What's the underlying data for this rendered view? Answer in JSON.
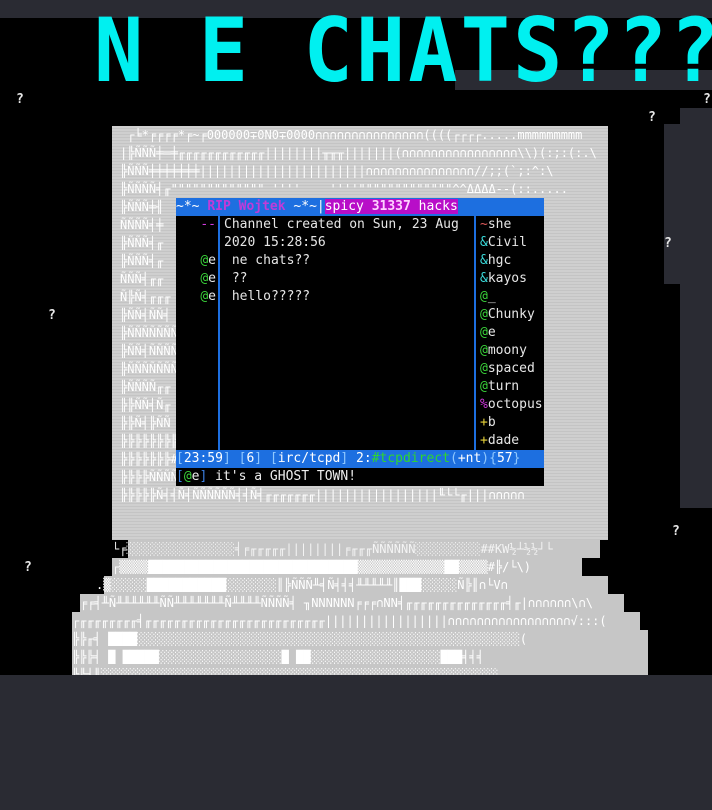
{
  "title": "N E CHATS???",
  "question_marks": [
    "?",
    "?",
    "?",
    "?",
    "?",
    "?",
    "?",
    "?"
  ],
  "ascii_art": {
    "monitor_lines": [
      " ┌╘*╒╒╒╒*╒~╒000000∓0N0∓0000∩∩∩∩∩∩∩∩∩∩∩∩∩∩∩((((┌┌┌┌.....mmmmmmmmm",
      "|╠ÑÑÑ╪═╪╓╓╓╓╓╓╓╓╓╓╓╓||||||||╥╥╥|||||||(∩∩∩∩∩∩∩∩∩∩∩∩∩∩∩∩\\\\)(:;:(:.\\",
      "╠ÑÑÑ╪╪╪╪╪╪╪|||||||||||||||||||||||∩∩∩∩∩∩∩∩∩∩∩∩∩∩∩//;;(`;:^:\\",
      "╠ÑÑÑÑ╡╓\"\"\"\"\"\"\"\"\"\"\"\"\" ''''    ''''\"\"\"\"\"\"\"\"\"\"\"\"\"^^ΔΔΔΔ--(::.....",
      "╠ÑÑÑ╪╢",
      "ÑÑÑÑ╡╪",
      "╠ÑÑÑ╡╓",
      "╠ÑÑÑ╡╓",
      "ÑÑÑ╡╓╓",
      "Ñ╠Ñ╡╓╓╓",
      "╠ÑÑ╡ÑÑ╡",
      "╠ÑÑÑÑÑÑÑ",
      "╠ÑÑ╡ÑÑÑÑ",
      "╠ÑÑÑÑÑÑÑ",
      "╠ÑÑÑÑ╓╓",
      "╠╠ÑÑ╡Ñ╓",
      "╠╠Ñ╡╠ÑÑ",
      "╠╠╠╠╠╠╠╠",
      "╠╠╠╠╠╠╠#M╠╠╠╠╠╠╠╠╠╠╠╠╠╠╠╠╠╠╠╠╠╠|||||||(∩∩∩∩∩∩∩∩∩∩∩∩∩∩∩",
      "╠╠╠╠ÑÑÑÑÑÑ╡╡ÑÑÑÑÑÑÑ╡╓╓╓╓╓╓╓╓||||||||||||||(∩|(∩∩∩∩∩∩∩∩",
      "╠╠╠╠╠Ñ╡╡Ñ╡ÑÑÑÑÑÑ╡╡Ñ╡╓╓╓╓╓╓╓|||||||||||||||||╙└└╓|||∩∩∩∩∩"
    ],
    "base_line_1": "└╒░░░░░░░░░░░░░░░╡╒╓╓╓╓╓||||||||╒╓╓╓ÑÑÑÑÑÑ░░░░░░░░░##KW½┴½½┘└",
    "base_line_2": "┌▒▒▒▒█████████████████████████████▒▒▒▒▒▒▒▒▒▒▒▒██▒▒▒▒#╠/└\\)",
    "base_line_3": ".▒░░░░░███████████░░░░░░░║╠ÑÑÑ╨╡Ñ╡╡╡╨╨╨╨╨║███░░░░░Ñ╠║∩└V∩",
    "base_line_4": "╒╒╡╨Ñ╨╨╨╨╨╨ÑÑ╨╨╨╨╨╨╨Ñ╨╨╨╨ÑÑÑÑ╡ ╖NNNNNN╒╒╒∩NN╡╓╓╓╓╓╓╓╓╓╓╓╓╓╓╡╓|∩∩∩∩∩∩\\∩\\",
    "base_line_5": "┌╓╓╓╓╓╓╓╓╡╓╓╓╓╓╓╓╓╓╓╓╓╓╓╓╓╓╓╓╓╓╓╓╓╓|||||||||||||||||∩∩∩∩∩∩∩∩∩∩∩∩∩∩∩∩∩√:::(",
    "base_line_6": "╠╠╓╡ ████░░░░░░░░░░░░░░░░░░░░░░░░░░░░░░░░░░░░░░░░░░░░░░░░░░░░░(",
    "base_line_7": "╠╠╠╡ █ █████░░░░░░░░░░░░░░░░░█ ██░░░░░░░░░░░░░░░░░░███╡╡╡",
    "base_line_8": "╠╠╡║░░░░░░░░░░░░░░░░░░░░░░░░░░░░░░░░░░░░░░░░░░░░░░░░░░░░░░░"
  },
  "irc": {
    "topbar": {
      "prefix": "~*~ ",
      "nick": "RIP Wojtek",
      "suffix": " ~*~|",
      "chan_a": "spicy ",
      "chan_num": "31337",
      "chan_b": " hacks"
    },
    "messages": [
      {
        "nick": "--",
        "text": "Channel created on Sun, 23 Aug",
        "nick_color": "#d23ae0"
      },
      {
        "nick": "",
        "text": "2020 15:28:56",
        "nick_color": "#d23ae0"
      },
      {
        "nick_prefix": "@",
        "nick": "e",
        "text": " ne chats??"
      },
      {
        "nick_prefix": "@",
        "nick": "e",
        "text": " ??"
      },
      {
        "nick_prefix": "@",
        "nick": "e",
        "text": " hello?????"
      }
    ],
    "userlist": [
      {
        "mode": "~",
        "name": "she",
        "mode_color": "#e05a5a"
      },
      {
        "mode": "&",
        "name": "Civil",
        "mode_color": "#3adada"
      },
      {
        "mode": "&",
        "name": "hgc",
        "mode_color": "#3adada"
      },
      {
        "mode": "&",
        "name": "kayos",
        "mode_color": "#3adada"
      },
      {
        "mode": "@",
        "name": "_",
        "mode_color": "#3ad33a"
      },
      {
        "mode": "@",
        "name": "Chunky",
        "mode_color": "#3ad33a"
      },
      {
        "mode": "@",
        "name": "e",
        "mode_color": "#3ad33a"
      },
      {
        "mode": "@",
        "name": "moony",
        "mode_color": "#3ad33a"
      },
      {
        "mode": "@",
        "name": "spaced",
        "mode_color": "#3ad33a"
      },
      {
        "mode": "@",
        "name": "turn",
        "mode_color": "#3ad33a"
      },
      {
        "mode": "%",
        "name": "octopus",
        "mode_color": "#d23ae0"
      },
      {
        "mode": "+",
        "name": "b",
        "mode_color": "#e8d43a"
      },
      {
        "mode": "+",
        "name": "dade",
        "mode_color": "#e8d43a"
      }
    ],
    "status": {
      "time": "23:59",
      "count": "6",
      "server": "irc/tcpd",
      "window_num": "2",
      "channel": "#tcpdirect",
      "modes": "+nt",
      "users": "57"
    },
    "input": {
      "prefix": "@",
      "nick": "e",
      "text": " it's a GHOST TOWN!"
    }
  },
  "colors": {
    "title": "#00f0f0",
    "bar": "#1d6fe0",
    "channel_bg": "#b80ec8",
    "background": "#000000",
    "frame": "#2a2b33"
  }
}
